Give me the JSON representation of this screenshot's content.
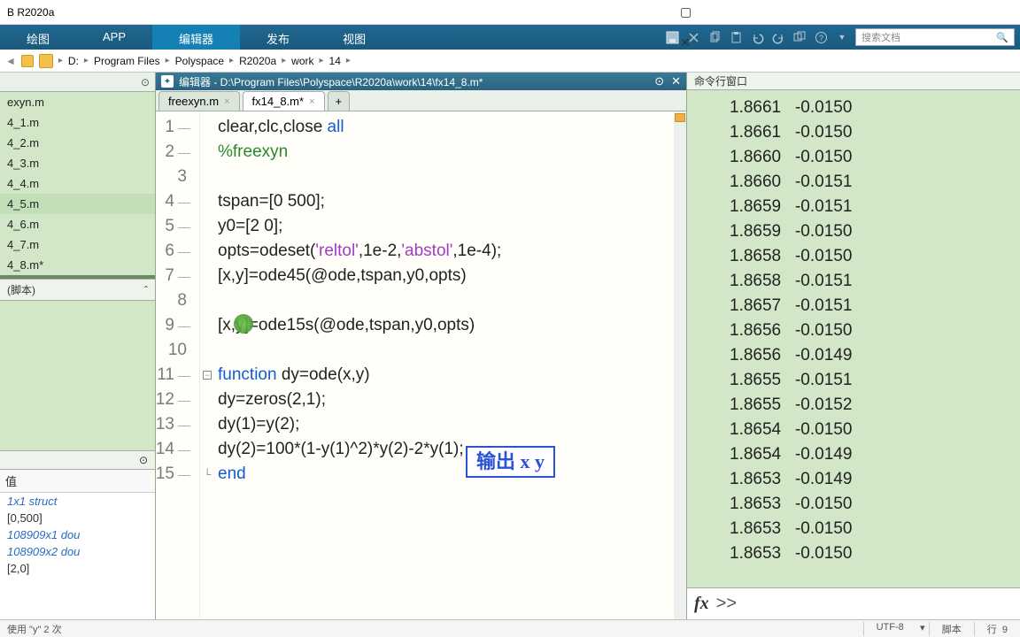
{
  "title": "B R2020a",
  "window_controls": {
    "min": "—",
    "max": "▢",
    "close": "✕"
  },
  "toolstrip": {
    "tabs": [
      "绘图",
      "APP",
      "编辑器",
      "发布",
      "视图"
    ],
    "active": 2,
    "search_placeholder": "搜索文档"
  },
  "breadcrumb": [
    "D:",
    "Program Files",
    "Polyspace",
    "R2020a",
    "work",
    "14"
  ],
  "files": {
    "list": [
      "exyn.m",
      "4_1.m",
      "4_2.m",
      "4_3.m",
      "4_4.m",
      "4_5.m",
      "4_6.m",
      "4_7.m",
      "4_8.m*"
    ],
    "selected": 5
  },
  "section_script": "(脚本)",
  "workspace": {
    "hdr_value": "值",
    "rows": [
      {
        "cls": "v-struct",
        "txt": "1x1 struct"
      },
      {
        "cls": "v-num",
        "txt": "[0,500]"
      },
      {
        "cls": "v-dbl",
        "txt": "108909x1 dou"
      },
      {
        "cls": "v-dbl",
        "txt": "108909x2 dou"
      },
      {
        "cls": "v-num",
        "txt": "[2,0]"
      }
    ]
  },
  "editor": {
    "title": "编辑器 - D:\\Program Files\\Polyspace\\R2020a\\work\\14\\fx14_8.m*",
    "tabs": [
      {
        "label": "freexyn.m",
        "active": false
      },
      {
        "label": "fx14_8.m*",
        "active": true
      }
    ],
    "lines": [
      {
        "n": 1,
        "html": "clear,clc,close <span class='kw'>all</span>"
      },
      {
        "n": 2,
        "html": "<span class='cmt'>%freexyn</span>"
      },
      {
        "n": 3,
        "html": ""
      },
      {
        "n": 4,
        "html": "tspan=[0 500];"
      },
      {
        "n": 5,
        "html": "y0=[2 0];"
      },
      {
        "n": 6,
        "html": "opts=odeset(<span class='str'>'reltol'</span>,1e-2,<span class='str'>'abstol'</span>,1e-4);"
      },
      {
        "n": 7,
        "html": "[x,y]=ode45(@ode,tspan,y0,opts)"
      },
      {
        "n": 8,
        "html": ""
      },
      {
        "n": 9,
        "html": "[x,y]=ode15s(@ode,tspan,y0,opts)"
      },
      {
        "n": 10,
        "html": ""
      },
      {
        "n": 11,
        "html": "<span class='kw'>function</span> dy=ode(x,y)"
      },
      {
        "n": 12,
        "html": "dy=zeros(2,1);"
      },
      {
        "n": 13,
        "html": "dy(1)=y(2);"
      },
      {
        "n": 14,
        "html": "dy(2)=100*(1-y(1)^2)*y(2)-2*y(1);"
      },
      {
        "n": 15,
        "html": "<span class='kw'>end</span>"
      }
    ],
    "annotation": "输出 x y"
  },
  "command_window": {
    "title": "命令行窗口",
    "rows": [
      [
        1.8661,
        -0.015
      ],
      [
        1.8661,
        -0.015
      ],
      [
        1.866,
        -0.015
      ],
      [
        1.866,
        -0.0151
      ],
      [
        1.8659,
        -0.0151
      ],
      [
        1.8659,
        -0.015
      ],
      [
        1.8658,
        -0.015
      ],
      [
        1.8658,
        -0.0151
      ],
      [
        1.8657,
        -0.0151
      ],
      [
        1.8656,
        -0.015
      ],
      [
        1.8656,
        -0.0149
      ],
      [
        1.8655,
        -0.0151
      ],
      [
        1.8655,
        -0.0152
      ],
      [
        1.8654,
        -0.015
      ],
      [
        1.8654,
        -0.0149
      ],
      [
        1.8653,
        -0.0149
      ],
      [
        1.8653,
        -0.015
      ],
      [
        1.8653,
        -0.015
      ],
      [
        1.8653,
        -0.015
      ]
    ],
    "prompt": ">>",
    "fx": "fx"
  },
  "statusbar": {
    "left": "使用 \"y\" 2 次",
    "encoding": "UTF-8",
    "mode": "脚本",
    "ln_label": "行",
    "ln": "9"
  }
}
